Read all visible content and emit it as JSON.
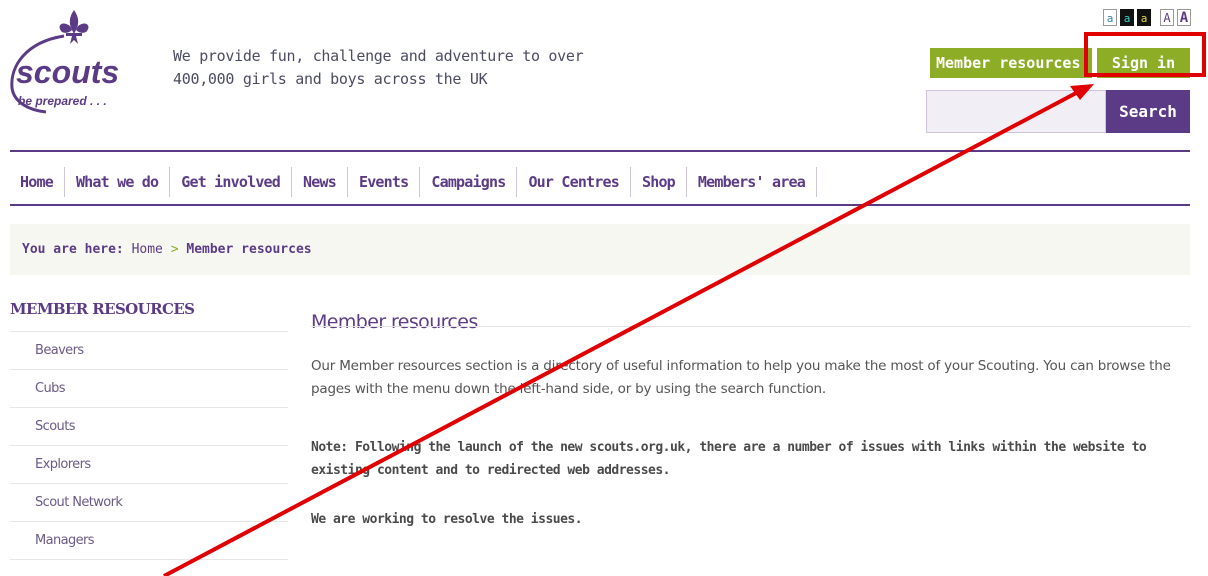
{
  "header": {
    "logo": {
      "word": "scouts",
      "motto": "be prepared . . ."
    },
    "tagline": "We provide fun, challenge and adventure to over 400,000 girls and boys across the UK",
    "text_size_controls": [
      "a",
      "a",
      "a",
      "A",
      "A"
    ],
    "buttons": {
      "member_resources": "Member resources",
      "sign_in": "Sign in"
    },
    "search": {
      "placeholder": "",
      "button": "Search"
    }
  },
  "nav": {
    "items": [
      "Home",
      "What we do",
      "Get involved",
      "News",
      "Events",
      "Campaigns",
      "Our Centres",
      "Shop",
      "Members' area"
    ]
  },
  "breadcrumb": {
    "lead": "You are here:",
    "home": "Home",
    "separator": ">",
    "current": "Member resources"
  },
  "sidebar": {
    "title": "MEMBER RESOURCES",
    "items": [
      "Beavers",
      "Cubs",
      "Scouts",
      "Explorers",
      "Scout Network",
      "Managers"
    ]
  },
  "main": {
    "title": "Member resources",
    "intro": "Our Member resources section is a directory of useful information to help you make the most of your Scouting. You can browse the pages with the menu down the left-hand side, or by using the search function.",
    "note": "Note: Following the launch of the new scouts.org.uk, there are a number of issues with links within the website to existing content and to redirected web addresses.",
    "resolve": "We are working to resolve the issues."
  },
  "colors": {
    "brand_purple": "#5c3b86",
    "button_green": "#8dad27",
    "annotation_red": "#e00000"
  }
}
